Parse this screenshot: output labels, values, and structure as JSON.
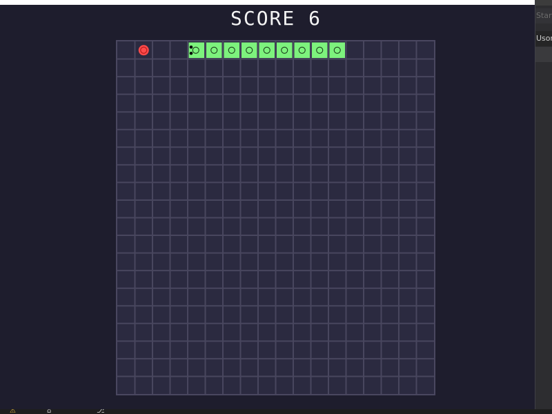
{
  "game": {
    "score_label": "SCORE 6",
    "grid": {
      "cols": 18,
      "rows": 20
    },
    "food": {
      "col": 1,
      "row": 0,
      "color": "#ff4a4a"
    },
    "snake": {
      "head": {
        "col": 4,
        "row": 0,
        "direction": "left"
      },
      "body": [
        {
          "col": 5,
          "row": 0
        },
        {
          "col": 6,
          "row": 0
        },
        {
          "col": 7,
          "row": 0
        },
        {
          "col": 8,
          "row": 0
        },
        {
          "col": 9,
          "row": 0
        },
        {
          "col": 10,
          "row": 0
        },
        {
          "col": 11,
          "row": 0
        },
        {
          "col": 12,
          "row": 0
        }
      ],
      "color": "#7df27d"
    },
    "colors": {
      "board": "#2b2a40",
      "grid_line": "#48465e"
    }
  },
  "ide": {
    "tab_1": "Start",
    "tab_2": "UsonC",
    "status_icons": [
      "warning-icon",
      "build-icon",
      "branch-icon"
    ]
  }
}
